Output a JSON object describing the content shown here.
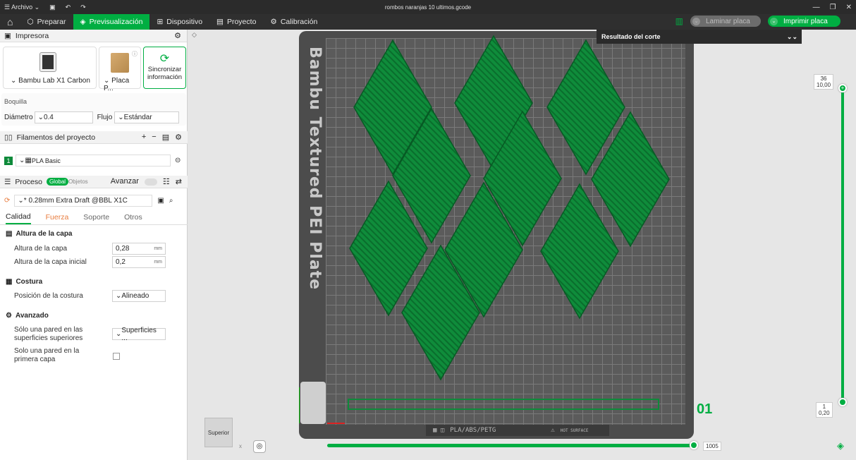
{
  "window": {
    "title": "rombos naranjas 10 ultimos.gcode",
    "menu": "Archivo"
  },
  "toolbar": {
    "tabs": [
      "Preparar",
      "Previsualización",
      "Dispositivo",
      "Proyecto",
      "Calibración"
    ],
    "slice": "Laminar placa",
    "print": "Imprimir placa"
  },
  "printer": {
    "header": "Impresora",
    "name": "Bambu Lab X1 Carbon",
    "plate": "Placa P...",
    "sync": "Sincronizar información",
    "nozzle_label": "Boquilla",
    "diameter_label": "Diámetro",
    "diameter": "0.4",
    "flow_label": "Flujo",
    "flow": "Estándar"
  },
  "filaments": {
    "header": "Filamentos del proyecto",
    "slot": "1",
    "name": "PLA Basic"
  },
  "process": {
    "header": "Proceso",
    "global": "Global",
    "objects": "Objetos",
    "advanced": "Avanzar",
    "profile": "* 0.28mm Extra Draft @BBL X1C",
    "tabs": [
      "Calidad",
      "Fuerza",
      "Soporte",
      "Otros"
    ]
  },
  "quality": {
    "layer_group": "Altura de la capa",
    "layer_height_label": "Altura de la capa",
    "layer_height": "0,28",
    "initial_label": "Altura de la capa inicial",
    "initial": "0,2",
    "unit": "mm",
    "seam_group": "Costura",
    "seam_label": "Posición de la costura",
    "seam": "Alineado",
    "adv_group": "Avanzado",
    "top_wall_label": "Sólo una pared en las superficies superiores",
    "top_wall": "Superficies ...",
    "first_wall_label": "Solo una pared en la primera capa"
  },
  "preview": {
    "result": "Resultado del corte",
    "plate_name": "Bambu Textured PEI Plate",
    "plate_footer": "PLA/ABS/PETG",
    "hot": "HOT SURFACE",
    "layer_top": "36",
    "height_top": "10,00",
    "layer_bottom": "1",
    "height_bottom": "0,20",
    "plate_number": "01",
    "move_count": "1005",
    "view": "Superior",
    "axis_x": "x"
  },
  "colors": {
    "accent": "#00ae42",
    "filament": "#0e8a3a"
  }
}
